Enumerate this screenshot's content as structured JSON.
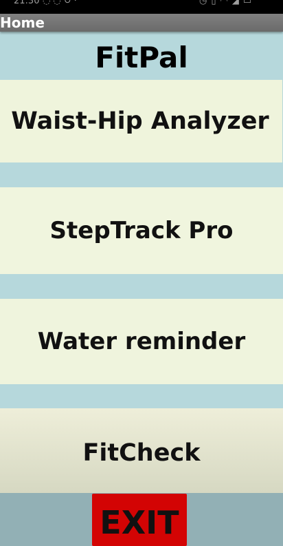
{
  "status_bar": {
    "time": "21:30",
    "left_icons": [
      "whatsapp-icon",
      "whatsapp-icon",
      "sync-icon",
      "dot-icon"
    ],
    "right_icons": [
      "alarm-icon",
      "vibrate-icon",
      "wifi-icon",
      "signal-icon",
      "battery-icon"
    ]
  },
  "action_bar": {
    "title": "Home"
  },
  "app": {
    "name": "FitPal"
  },
  "menu": {
    "items": [
      {
        "label": "Waist-Hip Analyzer"
      },
      {
        "label": "StepTrack Pro"
      },
      {
        "label": "Water reminder"
      },
      {
        "label": "FitCheck"
      }
    ]
  },
  "exit": {
    "label": "EXIT"
  },
  "colors": {
    "background": "#b6d8dc",
    "button_background": "#eff4dc",
    "exit_background": "#d30404",
    "action_bar": "#7a7a7a"
  }
}
